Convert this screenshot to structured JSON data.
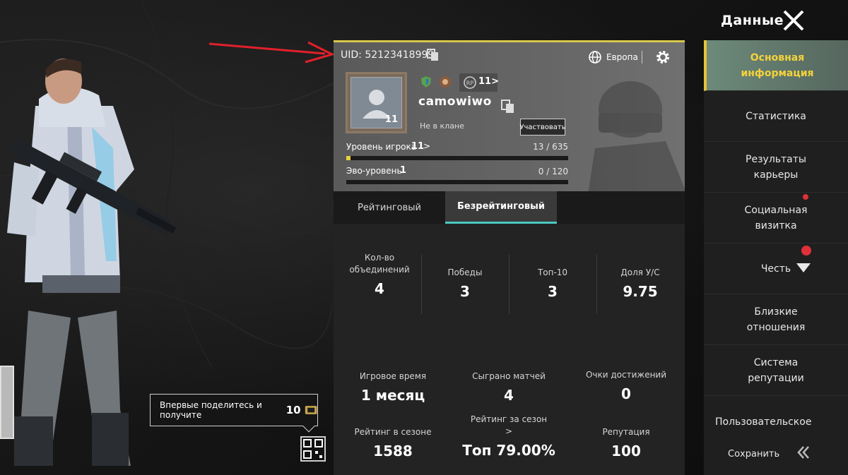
{
  "header": {
    "title": "Данные"
  },
  "profile": {
    "uid": "UID: 52123418999",
    "region": "Европа",
    "avatar_level": "11",
    "rank_text": "11>",
    "name": "camowiwo",
    "clan_status": "Не в клане",
    "join_label": "Участвовать",
    "level_label": "Уровень игрока",
    "level_value": "11",
    "level_chevron": ">",
    "level_progress": "13 / 635",
    "level_fraction": 0.02,
    "evo_label": "Эво-уровень",
    "evo_value": "1",
    "evo_progress": "0 / 120",
    "evo_fraction": 0.0
  },
  "tabs": {
    "ranked": "Рейтинговый",
    "unranked": "Безрейтинговый"
  },
  "stats": {
    "merges_label_line1": "Кол-во",
    "merges_label_line2": "объединений",
    "merges": "4",
    "wins_label": "Победы",
    "wins": "3",
    "top10_label": "Топ-10",
    "top10": "3",
    "kd_label": "Доля У/С",
    "kd": "9.75",
    "playtime_label": "Игровое время",
    "playtime": "1 месяц",
    "matches_label": "Сыграно матчей",
    "matches": "4",
    "achievements_label": "Очки достижений",
    "achievements": "0",
    "season_rating_label": "Рейтинг в сезоне",
    "season_rating": "1588",
    "season_top_label_line1": "Рейтинг за сезон",
    "season_top_label_line2": ">",
    "season_top": "Топ 79.00%",
    "reputation_label": "Репутация",
    "reputation": "100"
  },
  "sidebar": {
    "items": [
      {
        "line1": "Основная",
        "line2": "информация"
      },
      {
        "line1": "Статистика",
        "line2": ""
      },
      {
        "line1": "Результаты",
        "line2": "карьеры"
      },
      {
        "line1": "Социальная",
        "line2": "визитка"
      },
      {
        "line1": "Честь",
        "line2": ""
      },
      {
        "line1": "Близкие",
        "line2": "отношения"
      },
      {
        "line1": "Система",
        "line2": "репутации"
      }
    ],
    "custom": "Пользовательское",
    "save": "Сохранить"
  },
  "share": {
    "text": "Впервые поделитесь и получите",
    "reward": "10"
  },
  "colors": {
    "accent_yellow": "#e9d23a",
    "accent_teal": "#4bc7c0",
    "alert_red": "#e0303a"
  }
}
